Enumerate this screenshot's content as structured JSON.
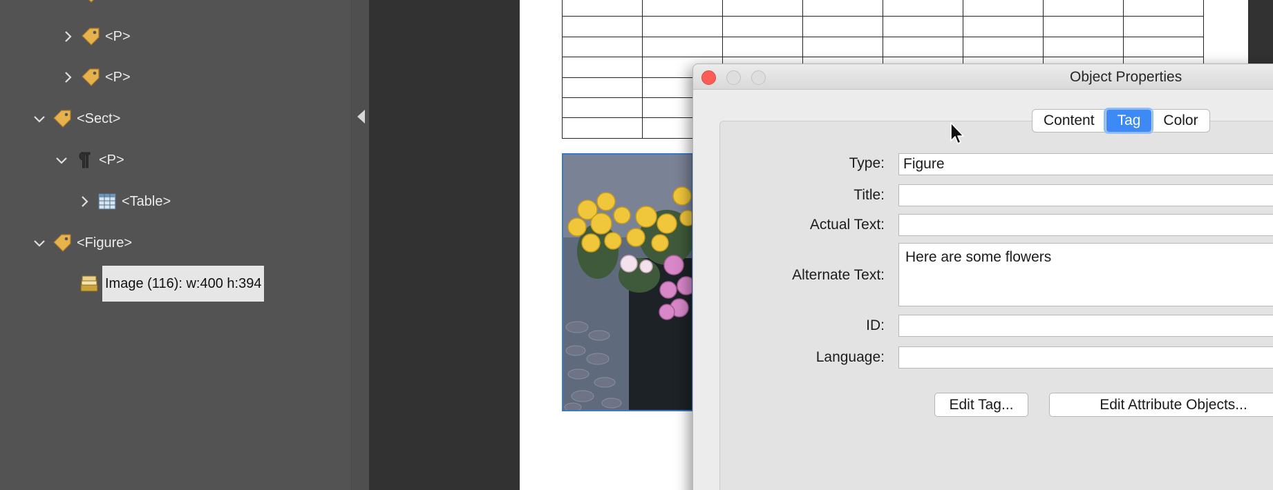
{
  "tags_tree": {
    "nodes": [
      {
        "label": "<P>",
        "icon": "tag-icon",
        "expanded": false
      },
      {
        "label": "<P>",
        "icon": "tag-icon",
        "expanded": false
      },
      {
        "label": "<Sect>",
        "icon": "tag-icon",
        "expanded": true
      },
      {
        "label": "<P>",
        "icon": "paragraph-icon",
        "expanded": true
      },
      {
        "label": "<Table>",
        "icon": "table-icon",
        "expanded": false
      },
      {
        "label": "<Figure>",
        "icon": "tag-icon",
        "expanded": true
      },
      {
        "label": "Image (116): w:400 h:394",
        "icon": "image-content-icon",
        "selected": true
      }
    ]
  },
  "dialog": {
    "title": "Object Properties",
    "tabs": [
      {
        "label": "Content",
        "active": false
      },
      {
        "label": "Tag",
        "active": true
      },
      {
        "label": "Color",
        "active": false
      }
    ],
    "fields": {
      "type": {
        "label": "Type:",
        "value": "Figure"
      },
      "title": {
        "label": "Title:",
        "value": ""
      },
      "actual_text": {
        "label": "Actual Text:",
        "value": ""
      },
      "alternate_text": {
        "label": "Alternate Text:",
        "value": "Here are some flowers"
      },
      "id": {
        "label": "ID:",
        "value": ""
      },
      "language": {
        "label": "Language:",
        "value": ""
      }
    },
    "buttons": {
      "edit_tag": "Edit Tag...",
      "edit_attribute_objects": "Edit Attribute Objects..."
    }
  },
  "colors": {
    "accent": "#3d8af7",
    "close_button": "#fc5d57",
    "panel_bg": "#535353",
    "figure_border": "#3a78c9"
  }
}
